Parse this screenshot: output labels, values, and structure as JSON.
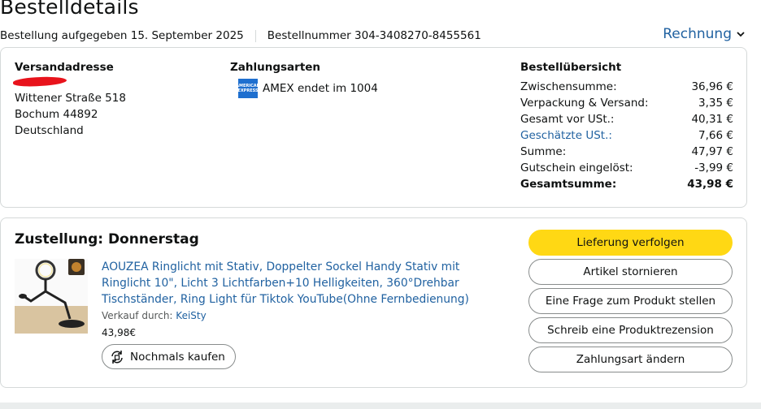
{
  "header": {
    "title": "Bestelldetails",
    "order_date": "Bestellung aufgegeben 15. September 2025",
    "order_number": "Bestellnummer 304-3408270-8455561",
    "invoice_label": "Rechnung"
  },
  "shipping": {
    "heading": "Versandadresse",
    "lines": [
      "Wittener Straße 518",
      "Bochum 44892",
      "Deutschland"
    ]
  },
  "payment": {
    "heading": "Zahlungsarten",
    "method": "AMEX endet im 1004",
    "card_logo_text": "AMERICAN EXPRESS"
  },
  "summary": {
    "heading": "Bestellübersicht",
    "rows": [
      {
        "label": "Zwischensumme:",
        "value": "36,96 €"
      },
      {
        "label": "Verpackung & Versand:",
        "value": "3,35 €"
      },
      {
        "label": "Gesamt vor USt.:",
        "value": "40,31 €"
      },
      {
        "label": "Geschätzte USt.:",
        "value": "7,66 €"
      },
      {
        "label": "Summe:",
        "value": "47,97 €"
      },
      {
        "label": "Gutschein eingelöst:",
        "value": "-3,99 €"
      },
      {
        "label": "Gesamtsumme:",
        "value": "43,98 €"
      }
    ]
  },
  "delivery": {
    "title": "Zustellung: Donnerstag",
    "product_title": "AOUZEA Ringlicht mit Stativ, Doppelter Sockel Handy Stativ mit Ringlicht 10\", Licht 3 Lichtfarben+10 Helligkeiten, 360°Drehbar Tischständer, Ring Light für Tiktok YouTube(Ohne Fernbedienung)",
    "seller_prefix": "Verkauf durch:",
    "seller_name": "KeiSty",
    "price": "43,98€",
    "rebuy_label": "Nochmals kaufen"
  },
  "actions": {
    "track": "Lieferung verfolgen",
    "cancel": "Artikel stornieren",
    "question": "Eine Frage zum Produkt stellen",
    "review": "Schreib eine Produktrezension",
    "payment_change": "Zahlungsart ändern"
  },
  "colors": {
    "link": "#2162a1",
    "primary_button": "#ffd814",
    "border": "#d5d9d9",
    "redaction": "#e8131c"
  }
}
